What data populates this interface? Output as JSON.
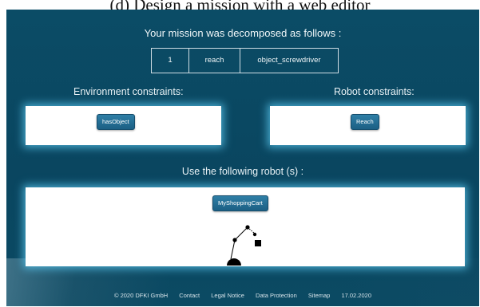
{
  "caption": "(d) Design a mission with a web editor",
  "header": {
    "title": "Your mission was decomposed as follows :"
  },
  "decomposition": {
    "step": "1",
    "action": "reach",
    "object": "object_screwdriver"
  },
  "environment": {
    "label": "Environment constraints:",
    "button": "hasObject"
  },
  "robot_constraints": {
    "label": "Robot constraints:",
    "button": "Reach"
  },
  "robots": {
    "label": "Use the following robot (s) :",
    "button": "MyShoppingCart"
  },
  "footer": {
    "copyright": "© 2020 DFKI GmbH",
    "links": [
      "Contact",
      "Legal Notice",
      "Data Protection",
      "Sitemap"
    ],
    "date": "17.02.2020"
  },
  "colors": {
    "background": "#0b4c66",
    "glow": "#5ac8f0",
    "button": "#1b5f84"
  },
  "icons": {
    "robot": "robot-arm-icon"
  }
}
